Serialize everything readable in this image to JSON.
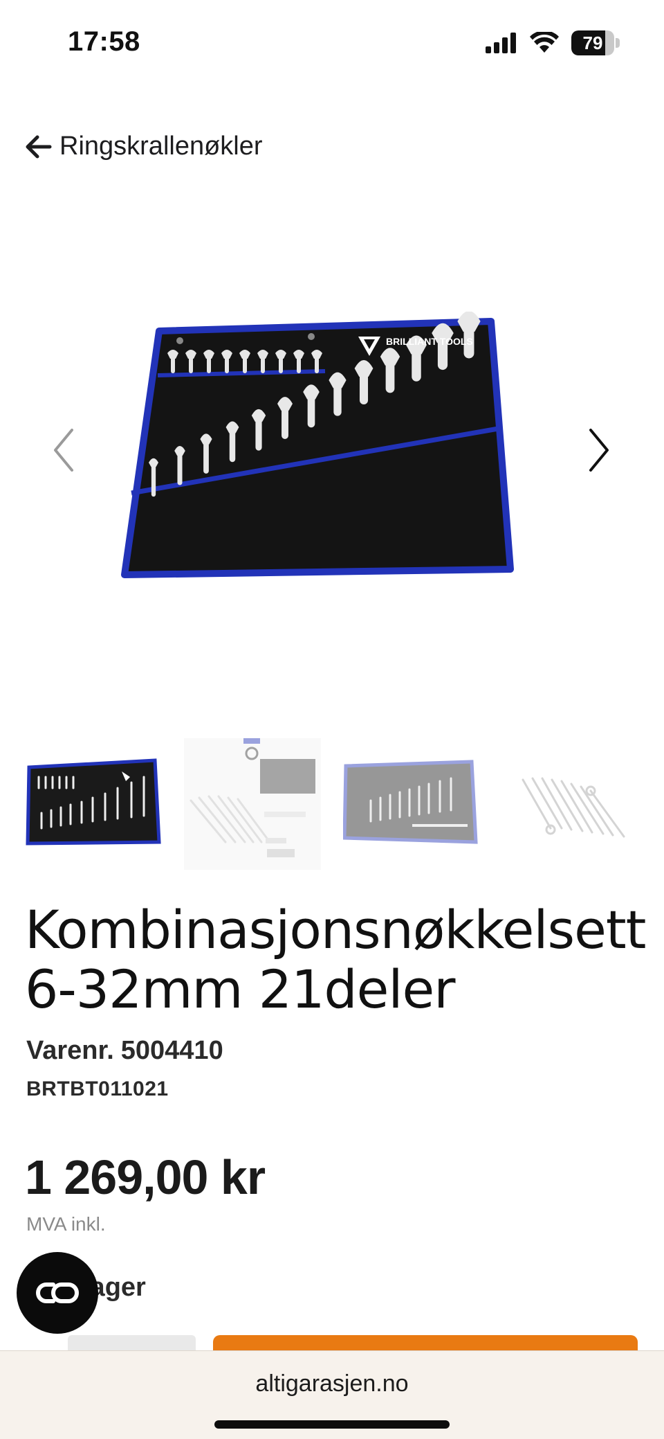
{
  "status_bar": {
    "time": "17:58",
    "battery_level": "79",
    "battery_fraction": 0.79,
    "icons": [
      "cellular-signal-icon",
      "wifi-icon",
      "battery-icon"
    ]
  },
  "nav": {
    "back_label": "Ringskrallenøkler",
    "back_icon": "arrow-left-icon"
  },
  "gallery": {
    "main_image": "combination-wrench-set-pouch",
    "prev_icon": "chevron-left-icon",
    "next_icon": "chevron-right-icon",
    "thumbnails": [
      {
        "name": "wrench-set-pouch-front",
        "active": true
      },
      {
        "name": "wrench-set-packaging",
        "active": false
      },
      {
        "name": "wrench-set-pouch-back",
        "active": false
      },
      {
        "name": "wrench-set-loose",
        "active": false
      }
    ],
    "brand_text": "BRILLIANT TOOLS"
  },
  "product": {
    "title": "Kombinasjonsnøkkelsett 6-32mm 21deler",
    "sku_label": "Varenr.",
    "sku_value": "5004410",
    "mpn": "BRTBT011021",
    "price": "1 269,00 kr",
    "vat_note": "MVA inkl.",
    "stock_text": "lager"
  },
  "colors": {
    "accent_orange": "#e97a12",
    "pouch_blue": "#2233b8",
    "text_dark": "#1b1b1b",
    "muted": "#8a8a8a"
  },
  "browser": {
    "url": "altigarasjen.no"
  }
}
